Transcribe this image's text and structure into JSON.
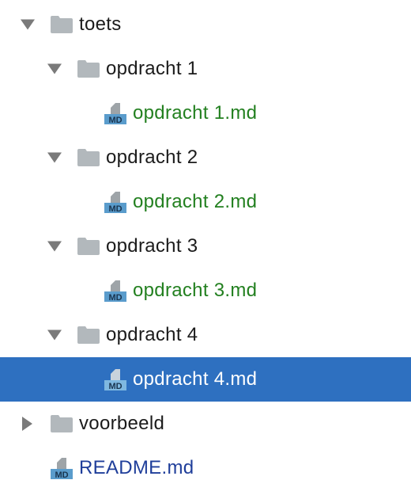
{
  "colors": {
    "selection": "#2e70c0",
    "modified_file": "#238020",
    "changed_file": "#1f3e9a",
    "folder": "#b2b8bc",
    "md_badge": "#5a9ccc"
  },
  "icons": {
    "folder": "folder-icon",
    "markdown": "markdown-file-icon",
    "expanded": "chevron-down-icon",
    "collapsed": "chevron-right-icon"
  },
  "tree": {
    "toets": {
      "label": "toets",
      "state": "expanded"
    },
    "opdracht1": {
      "label": "opdracht 1",
      "state": "expanded"
    },
    "opdracht1_md": {
      "label": "opdracht 1.md",
      "md": "MD"
    },
    "opdracht2": {
      "label": "opdracht 2",
      "state": "expanded"
    },
    "opdracht2_md": {
      "label": "opdracht 2.md",
      "md": "MD"
    },
    "opdracht3": {
      "label": "opdracht 3",
      "state": "expanded"
    },
    "opdracht3_md": {
      "label": "opdracht 3.md",
      "md": "MD"
    },
    "opdracht4": {
      "label": "opdracht 4",
      "state": "expanded"
    },
    "opdracht4_md": {
      "label": "opdracht 4.md",
      "md": "MD",
      "selected": true
    },
    "voorbeeld": {
      "label": "voorbeeld",
      "state": "collapsed"
    },
    "readme": {
      "label": "README.md",
      "md": "MD"
    }
  }
}
